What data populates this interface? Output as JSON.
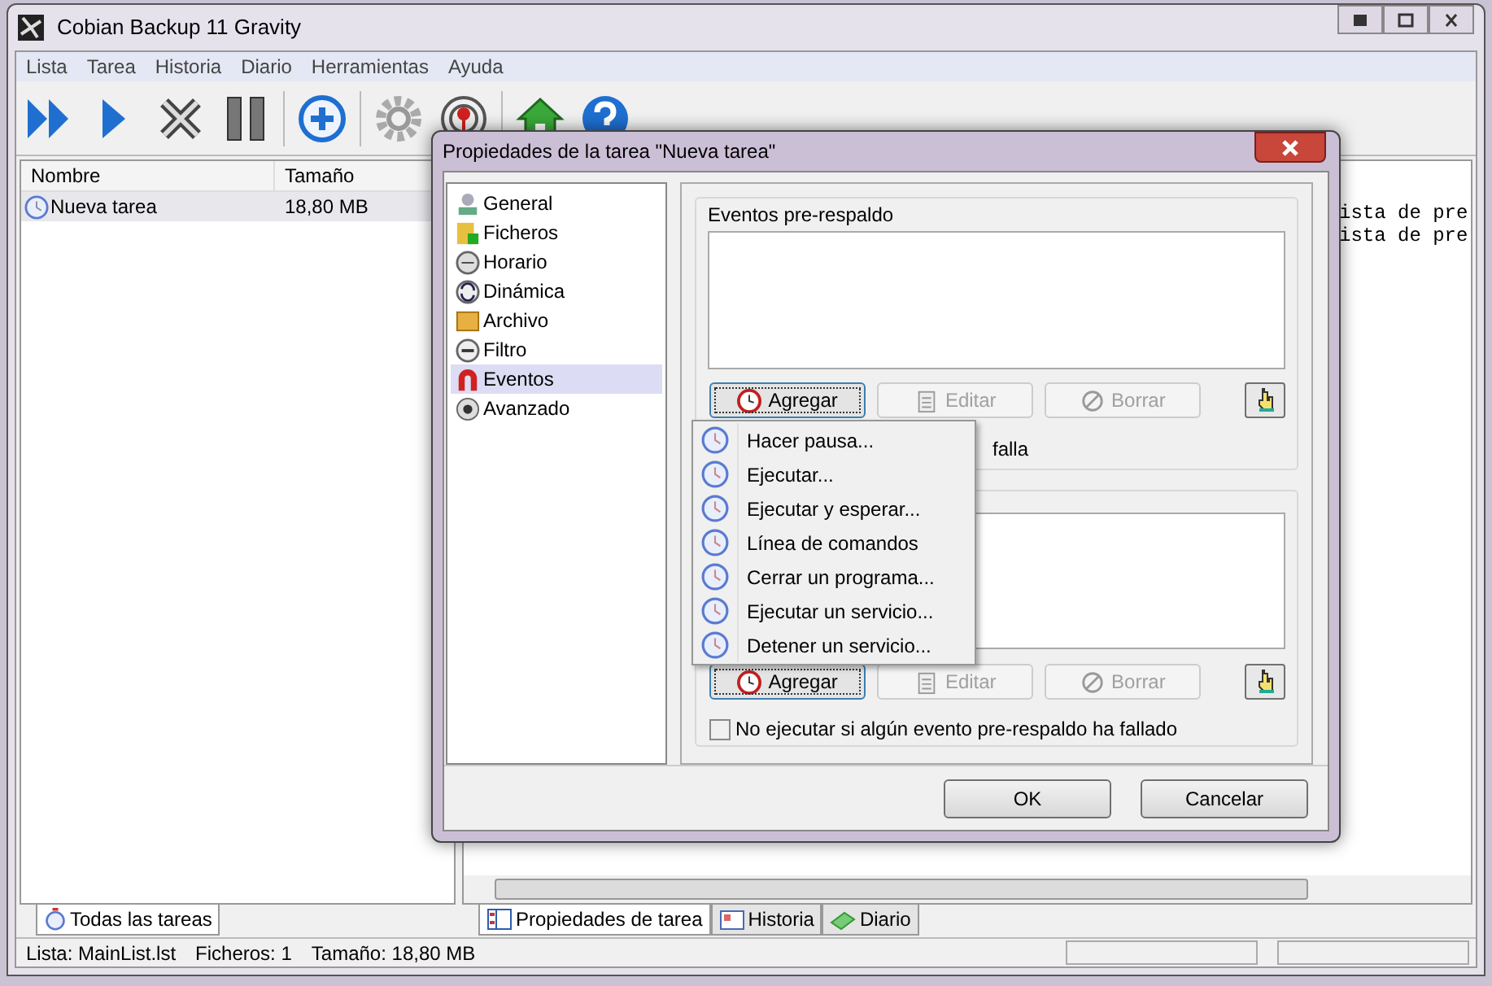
{
  "window": {
    "title": "Cobian Backup 11 Gravity"
  },
  "menu_bar": [
    "Lista",
    "Tarea",
    "Historia",
    "Diario",
    "Herramientas",
    "Ayuda"
  ],
  "task_list": {
    "columns": [
      "Nombre",
      "Tamaño"
    ],
    "rows": [
      {
        "name": "Nueva tarea",
        "size": "18,80 MB",
        "selected": true
      }
    ]
  },
  "left_tabs": [
    {
      "label": "Todas las tareas",
      "selected": true
    }
  ],
  "log_lines": [
    "ista de pre",
    "ista de pre"
  ],
  "bottom_tabs": [
    {
      "label": "Propiedades de tarea",
      "selected": true
    },
    {
      "label": "Historia",
      "selected": false
    },
    {
      "label": "Diario",
      "selected": false
    }
  ],
  "status_bar": {
    "list": "Lista: MainList.lst",
    "files": "Ficheros: 1",
    "size": "Tamaño: 18,80 MB"
  },
  "dialog": {
    "title": "Propiedades de la tarea \"Nueva tarea\"",
    "sections": [
      {
        "label": "General",
        "selected": false
      },
      {
        "label": "Ficheros",
        "selected": false
      },
      {
        "label": "Horario",
        "selected": false
      },
      {
        "label": "Dinámica",
        "selected": false
      },
      {
        "label": "Archivo",
        "selected": false
      },
      {
        "label": "Filtro",
        "selected": false
      },
      {
        "label": "Eventos",
        "selected": true
      },
      {
        "label": "Avanzado",
        "selected": false
      }
    ],
    "pre_group": {
      "title": "Eventos pre-respaldo",
      "buttons": [
        {
          "label": "Agregar",
          "disabled": false
        },
        {
          "label": "Editar",
          "disabled": true
        },
        {
          "label": "Borrar",
          "disabled": true
        }
      ],
      "checkbox_text_fragment": "falla"
    },
    "post_group": {
      "buttons": [
        {
          "label": "Agregar",
          "disabled": false
        },
        {
          "label": "Editar",
          "disabled": true
        },
        {
          "label": "Borrar",
          "disabled": true
        }
      ],
      "checkbox": {
        "label": "No ejecutar si algún evento pre-respaldo ha fallado",
        "checked": false
      }
    },
    "buttons": [
      "OK",
      "Cancelar"
    ]
  },
  "dropdown_menu": {
    "items": [
      "Hacer pausa...",
      "Ejecutar...",
      "Ejecutar y esperar...",
      "Línea de comandos",
      "Cerrar un programa...",
      "Ejecutar un servicio...",
      "Detener un servicio..."
    ]
  }
}
